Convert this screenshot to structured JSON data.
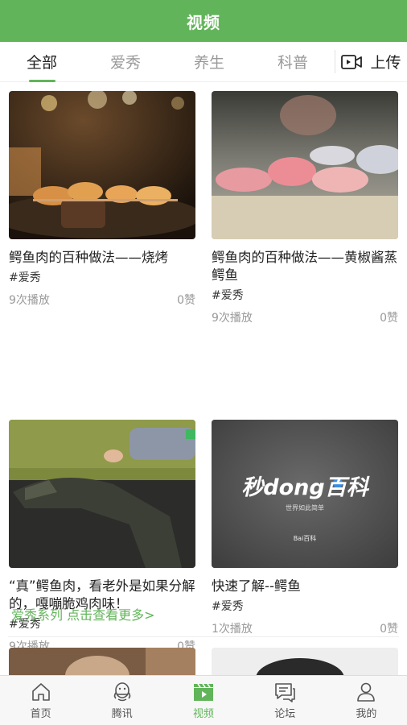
{
  "header": {
    "title": "视频"
  },
  "tabs": [
    {
      "label": "全部",
      "active": true
    },
    {
      "label": "爱秀",
      "active": false
    },
    {
      "label": "养生",
      "active": false
    },
    {
      "label": "科普",
      "active": false
    }
  ],
  "upload": {
    "label": "上传",
    "icon": "video-camera-icon"
  },
  "videos": [
    {
      "title": "鳄鱼肉的百种做法——烧烤",
      "tag": "#爱秀",
      "plays": "9次播放",
      "likes": "0赞"
    },
    {
      "title": "鳄鱼肉的百种做法——黄椒酱蒸鳄鱼",
      "tag": "#爱秀",
      "plays": "9次播放",
      "likes": "0赞"
    },
    {
      "title": "“真”鳄鱼肉，看老外是如果分解的，嘎嘣脆鸡肉味！",
      "tag": "#爱秀",
      "plays": "9次播放",
      "likes": "0赞"
    },
    {
      "title": "快速了解--鳄鱼",
      "tag": "#爱秀",
      "plays": "1次播放",
      "likes": "0赞"
    }
  ],
  "baike": {
    "logo_text": "秒dong百科",
    "slogan": "世界如此简单",
    "brand": "Bai百科"
  },
  "section_more": "爱秀系列 点击查看更多>",
  "bottom_nav": [
    {
      "label": "首页",
      "icon": "home-icon",
      "active": false
    },
    {
      "label": "腾讯",
      "icon": "penguin-icon",
      "active": false
    },
    {
      "label": "视频",
      "icon": "clapperboard-icon",
      "active": true
    },
    {
      "label": "论坛",
      "icon": "chat-icon",
      "active": false
    },
    {
      "label": "我的",
      "icon": "user-icon",
      "active": false
    }
  ],
  "colors": {
    "brand_green": "#62b45a"
  }
}
